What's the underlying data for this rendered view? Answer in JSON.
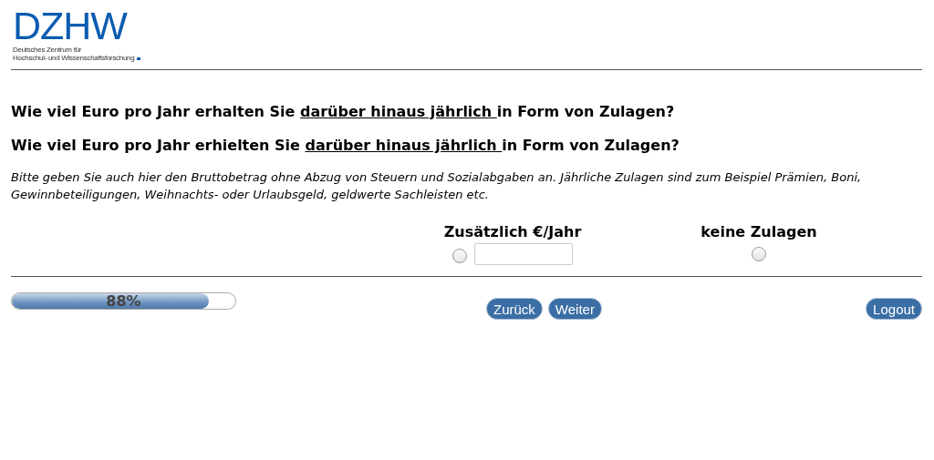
{
  "logo": {
    "mark": "DZHW",
    "line_1": "Deutsches Zentrum für",
    "line_2": "Hochschul- und Wissenschaftsforschung"
  },
  "questions": [
    {
      "before": "Wie viel Euro pro Jahr erhalten Sie ",
      "underlined": "darüber hinaus jährlich ",
      "after": "in Form von Zulagen?"
    },
    {
      "before": "Wie viel Euro pro Jahr erhielten Sie ",
      "underlined": "darüber hinaus jährlich ",
      "after": "in Form von Zulagen?"
    }
  ],
  "instruction": "Bitte geben Sie auch hier den Bruttobetrag ohne Abzug von Steuern und Sozialabgaben an. Jährliche Zulagen sind zum Beispiel Prämien, Boni, Gewinnbeteiligungen, Weihnachts- oder Urlaubsgeld, geldwerte Sachleisten etc.",
  "options": [
    {
      "kind": "amount",
      "label": "Zusätzlich €/Jahr",
      "selected": false
    },
    {
      "kind": "plain",
      "label": "keine Zulagen",
      "selected": false
    }
  ],
  "progress": {
    "level": 0.88,
    "reading": "88%"
  },
  "nav_buttons": [
    "Zurück",
    "Weiter"
  ],
  "logout": "Logout"
}
